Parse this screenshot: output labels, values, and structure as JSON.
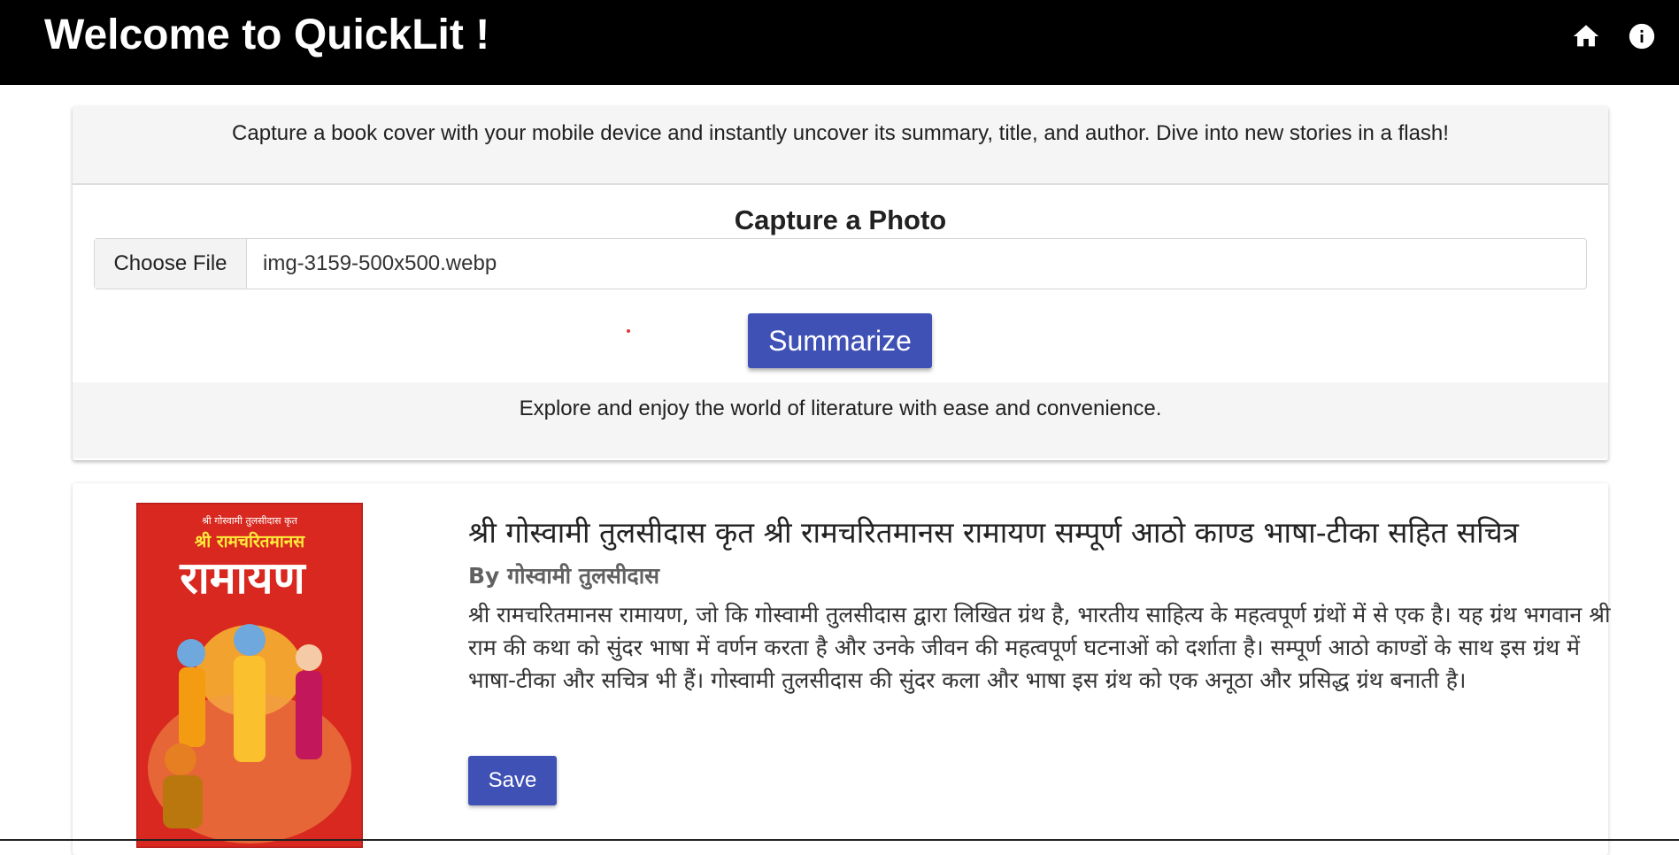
{
  "header": {
    "title": "Welcome to QuickLit !",
    "icons": [
      "home-icon",
      "info-icon"
    ]
  },
  "upload_card": {
    "intro": "Capture a book cover with your mobile device and instantly uncover its summary, title, and author. Dive into new stories in a flash!",
    "capture_title": "Capture a Photo",
    "choose_file_label": "Choose File",
    "file_name": "img-3159-500x500.webp",
    "summarize_label": "Summarize",
    "footer": "Explore and enjoy the world of literature with ease and convenience."
  },
  "result": {
    "cover_top": "श्री गोस्वामी तुलसीदास कृत",
    "cover_sub": "श्री रामचरितमानस",
    "cover_main": "रामायण",
    "title": "श्री गोस्वामी तुलसीदास कृत श्री रामचरितमानस रामायण सम्पूर्ण आठो काण्ड भाषा-टीका सहित सचित्र",
    "author_prefix": "By",
    "author": "गोस्वामी तुलसीदास",
    "summary": "श्री रामचरितमानस रामायण, जो कि गोस्वामी तुलसीदास द्वारा लिखित ग्रंथ है, भारतीय साहित्य के महत्वपूर्ण ग्रंथों में से एक है। यह ग्रंथ भगवान श्री राम की कथा को सुंदर भाषा में वर्णन करता है और उनके जीवन की महत्वपूर्ण घटनाओं को दर्शाता है। सम्पूर्ण आठो काण्डों के साथ इस ग्रंथ में भाषा-टीका और सचित्र भी हैं। गोस्वामी तुलसीदास की सुंदर कला और भाषा इस ग्रंथ को एक अनूठा और प्रसिद्ध ग्रंथ बनाती है।",
    "save_label": "Save"
  },
  "colors": {
    "topbar": "#000000",
    "primary_button": "#3f51b5",
    "panel_bg": "#f5f5f5",
    "cover_red": "#d8281f"
  }
}
